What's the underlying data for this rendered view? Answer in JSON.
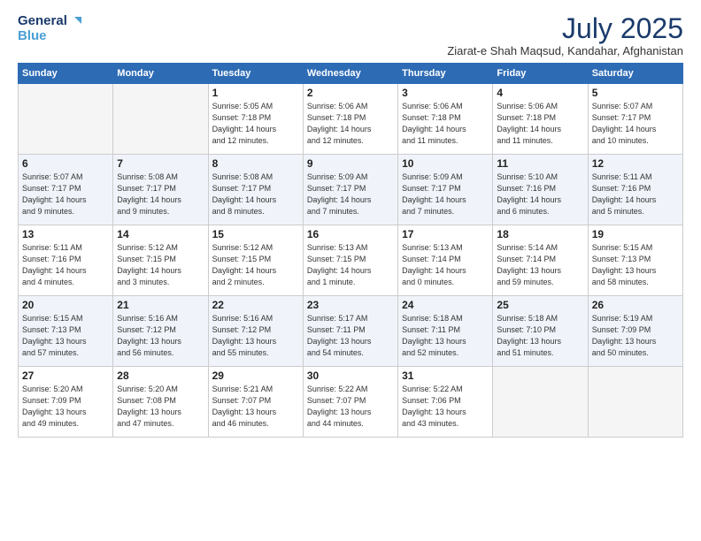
{
  "logo": {
    "line1": "General",
    "line2": "Blue"
  },
  "header": {
    "month_year": "July 2025",
    "location": "Ziarat-e Shah Maqsud, Kandahar, Afghanistan"
  },
  "days_of_week": [
    "Sunday",
    "Monday",
    "Tuesday",
    "Wednesday",
    "Thursday",
    "Friday",
    "Saturday"
  ],
  "weeks": [
    [
      {
        "day": "",
        "info": ""
      },
      {
        "day": "",
        "info": ""
      },
      {
        "day": "1",
        "info": "Sunrise: 5:05 AM\nSunset: 7:18 PM\nDaylight: 14 hours\nand 12 minutes."
      },
      {
        "day": "2",
        "info": "Sunrise: 5:06 AM\nSunset: 7:18 PM\nDaylight: 14 hours\nand 12 minutes."
      },
      {
        "day": "3",
        "info": "Sunrise: 5:06 AM\nSunset: 7:18 PM\nDaylight: 14 hours\nand 11 minutes."
      },
      {
        "day": "4",
        "info": "Sunrise: 5:06 AM\nSunset: 7:18 PM\nDaylight: 14 hours\nand 11 minutes."
      },
      {
        "day": "5",
        "info": "Sunrise: 5:07 AM\nSunset: 7:17 PM\nDaylight: 14 hours\nand 10 minutes."
      }
    ],
    [
      {
        "day": "6",
        "info": "Sunrise: 5:07 AM\nSunset: 7:17 PM\nDaylight: 14 hours\nand 9 minutes."
      },
      {
        "day": "7",
        "info": "Sunrise: 5:08 AM\nSunset: 7:17 PM\nDaylight: 14 hours\nand 9 minutes."
      },
      {
        "day": "8",
        "info": "Sunrise: 5:08 AM\nSunset: 7:17 PM\nDaylight: 14 hours\nand 8 minutes."
      },
      {
        "day": "9",
        "info": "Sunrise: 5:09 AM\nSunset: 7:17 PM\nDaylight: 14 hours\nand 7 minutes."
      },
      {
        "day": "10",
        "info": "Sunrise: 5:09 AM\nSunset: 7:17 PM\nDaylight: 14 hours\nand 7 minutes."
      },
      {
        "day": "11",
        "info": "Sunrise: 5:10 AM\nSunset: 7:16 PM\nDaylight: 14 hours\nand 6 minutes."
      },
      {
        "day": "12",
        "info": "Sunrise: 5:11 AM\nSunset: 7:16 PM\nDaylight: 14 hours\nand 5 minutes."
      }
    ],
    [
      {
        "day": "13",
        "info": "Sunrise: 5:11 AM\nSunset: 7:16 PM\nDaylight: 14 hours\nand 4 minutes."
      },
      {
        "day": "14",
        "info": "Sunrise: 5:12 AM\nSunset: 7:15 PM\nDaylight: 14 hours\nand 3 minutes."
      },
      {
        "day": "15",
        "info": "Sunrise: 5:12 AM\nSunset: 7:15 PM\nDaylight: 14 hours\nand 2 minutes."
      },
      {
        "day": "16",
        "info": "Sunrise: 5:13 AM\nSunset: 7:15 PM\nDaylight: 14 hours\nand 1 minute."
      },
      {
        "day": "17",
        "info": "Sunrise: 5:13 AM\nSunset: 7:14 PM\nDaylight: 14 hours\nand 0 minutes."
      },
      {
        "day": "18",
        "info": "Sunrise: 5:14 AM\nSunset: 7:14 PM\nDaylight: 13 hours\nand 59 minutes."
      },
      {
        "day": "19",
        "info": "Sunrise: 5:15 AM\nSunset: 7:13 PM\nDaylight: 13 hours\nand 58 minutes."
      }
    ],
    [
      {
        "day": "20",
        "info": "Sunrise: 5:15 AM\nSunset: 7:13 PM\nDaylight: 13 hours\nand 57 minutes."
      },
      {
        "day": "21",
        "info": "Sunrise: 5:16 AM\nSunset: 7:12 PM\nDaylight: 13 hours\nand 56 minutes."
      },
      {
        "day": "22",
        "info": "Sunrise: 5:16 AM\nSunset: 7:12 PM\nDaylight: 13 hours\nand 55 minutes."
      },
      {
        "day": "23",
        "info": "Sunrise: 5:17 AM\nSunset: 7:11 PM\nDaylight: 13 hours\nand 54 minutes."
      },
      {
        "day": "24",
        "info": "Sunrise: 5:18 AM\nSunset: 7:11 PM\nDaylight: 13 hours\nand 52 minutes."
      },
      {
        "day": "25",
        "info": "Sunrise: 5:18 AM\nSunset: 7:10 PM\nDaylight: 13 hours\nand 51 minutes."
      },
      {
        "day": "26",
        "info": "Sunrise: 5:19 AM\nSunset: 7:09 PM\nDaylight: 13 hours\nand 50 minutes."
      }
    ],
    [
      {
        "day": "27",
        "info": "Sunrise: 5:20 AM\nSunset: 7:09 PM\nDaylight: 13 hours\nand 49 minutes."
      },
      {
        "day": "28",
        "info": "Sunrise: 5:20 AM\nSunset: 7:08 PM\nDaylight: 13 hours\nand 47 minutes."
      },
      {
        "day": "29",
        "info": "Sunrise: 5:21 AM\nSunset: 7:07 PM\nDaylight: 13 hours\nand 46 minutes."
      },
      {
        "day": "30",
        "info": "Sunrise: 5:22 AM\nSunset: 7:07 PM\nDaylight: 13 hours\nand 44 minutes."
      },
      {
        "day": "31",
        "info": "Sunrise: 5:22 AM\nSunset: 7:06 PM\nDaylight: 13 hours\nand 43 minutes."
      },
      {
        "day": "",
        "info": ""
      },
      {
        "day": "",
        "info": ""
      }
    ]
  ]
}
